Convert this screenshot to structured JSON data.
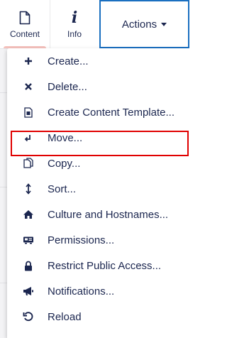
{
  "header": {
    "tabs": [
      {
        "label": "Content",
        "icon": "document-icon",
        "active": true
      },
      {
        "label": "Info",
        "icon": "info-icon",
        "active": false
      }
    ],
    "actions_label": "Actions",
    "colors": {
      "accent_border": "#1a6fc0",
      "text": "#1b264f",
      "active_tab_bar": "#f5c1bc"
    }
  },
  "menu": {
    "highlighted_item": "Copy...",
    "highlight_color": "#e00000",
    "items": [
      {
        "label": "Create...",
        "icon": "plus-icon"
      },
      {
        "label": "Delete...",
        "icon": "x-icon"
      },
      {
        "label": "Create Content Template...",
        "icon": "template-icon"
      },
      {
        "label": "Move...",
        "icon": "move-icon"
      },
      {
        "label": "Copy...",
        "icon": "copy-icon"
      },
      {
        "label": "Sort...",
        "icon": "sort-icon"
      },
      {
        "label": "Culture and Hostnames...",
        "icon": "home-icon"
      },
      {
        "label": "Permissions...",
        "icon": "permissions-icon"
      },
      {
        "label": "Restrict Public Access...",
        "icon": "lock-icon"
      },
      {
        "label": "Notifications...",
        "icon": "megaphone-icon"
      },
      {
        "label": "Reload",
        "icon": "reload-icon"
      }
    ]
  }
}
